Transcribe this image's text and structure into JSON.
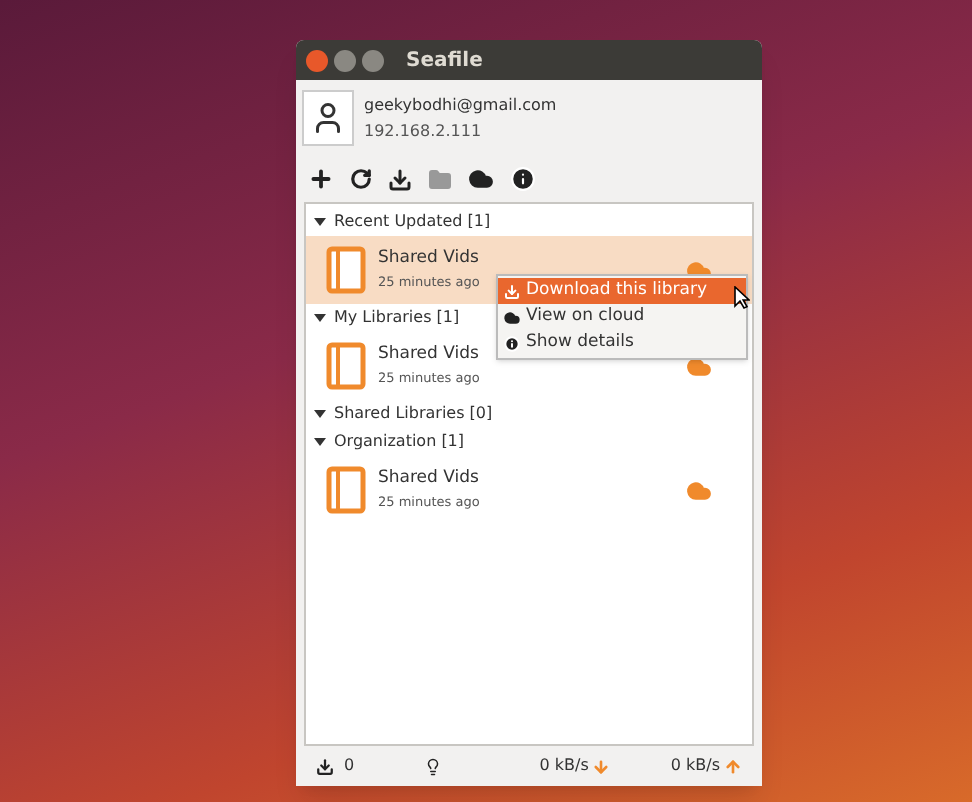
{
  "window": {
    "title": "Seafile"
  },
  "account": {
    "email": "geekybodhi@gmail.com",
    "server": "192.168.2.111"
  },
  "sections": [
    {
      "title": "Recent Updated [1]",
      "expanded": true,
      "items": [
        {
          "name": "Shared Vids",
          "time": "25 minutes ago",
          "selected": true
        }
      ]
    },
    {
      "title": "My Libraries [1]",
      "expanded": true,
      "items": [
        {
          "name": "Shared Vids",
          "time": "25 minutes ago",
          "selected": false
        }
      ]
    },
    {
      "title": "Shared Libraries [0]",
      "expanded": true
    },
    {
      "title": "Organization [1]",
      "expanded": true,
      "items": [
        {
          "name": "Shared Vids",
          "time": "25 minutes ago",
          "selected": false
        }
      ]
    }
  ],
  "context_menu": {
    "items": [
      {
        "label": "Download this library",
        "kind": "download",
        "selected": true
      },
      {
        "label": "View on cloud",
        "kind": "cloud",
        "selected": false
      },
      {
        "label": "Show details",
        "kind": "info",
        "selected": false
      }
    ]
  },
  "status_bar": {
    "tasks": "0",
    "download_rate": "0 kB/s",
    "upload_rate": "0 kB/s"
  }
}
